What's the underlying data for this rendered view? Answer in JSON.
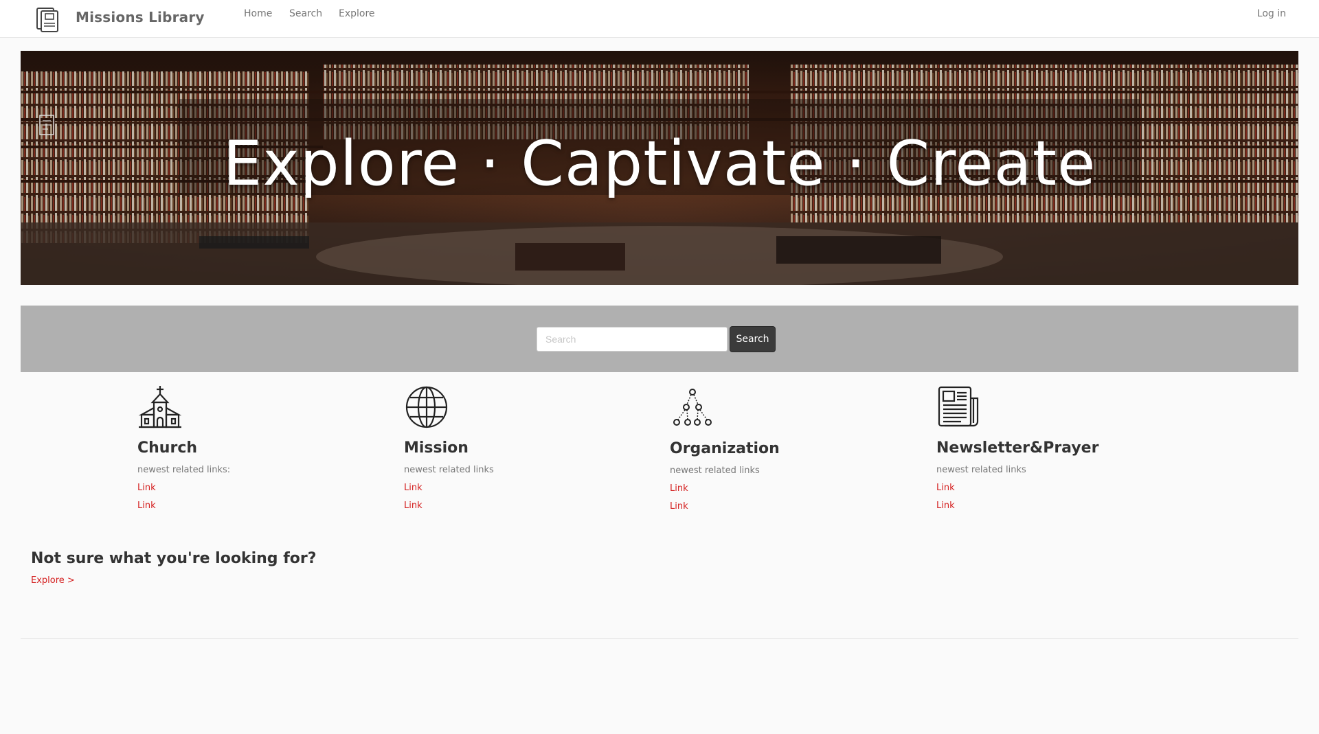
{
  "navbar": {
    "brand": "Missions Library",
    "links": [
      "Home",
      "Search",
      "Explore"
    ],
    "login": "Log in"
  },
  "hero": {
    "tagline": "Explore · Captivate · Create"
  },
  "search": {
    "placeholder": "Search",
    "button_label": "Search"
  },
  "categories": [
    {
      "title": "Church",
      "subtitle": "newest related links:",
      "links": [
        "Link",
        "Link"
      ],
      "icon": "church-icon"
    },
    {
      "title": "Mission",
      "subtitle": "newest related links",
      "links": [
        "Link",
        "Link"
      ],
      "icon": "globe-icon"
    },
    {
      "title": "Organization",
      "subtitle": "newest related links",
      "links": [
        "Link",
        "Link"
      ],
      "icon": "hierarchy-icon"
    },
    {
      "title": "Newsletter&Prayer",
      "subtitle": "newest related links",
      "links": [
        "Link",
        "Link"
      ],
      "icon": "newspaper-icon"
    }
  ],
  "explore": {
    "heading": "Not sure what you're looking for?",
    "link": "Explore >"
  },
  "colors": {
    "link": "#d42020",
    "search_band": "#b0b0b0",
    "button": "#3b3b3b"
  }
}
